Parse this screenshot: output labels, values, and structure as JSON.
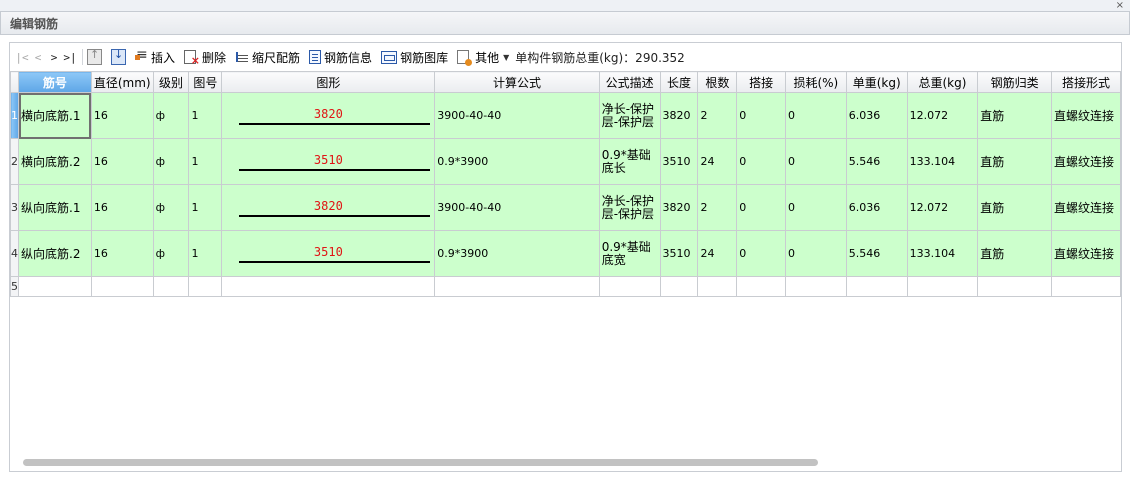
{
  "window": {
    "title": "编辑钢筋",
    "close_glyph": "×"
  },
  "toolbar": {
    "nav": {
      "first": "|<",
      "prev": "<",
      "next": ">",
      "last": ">|"
    },
    "insert_label": "插入",
    "delete_label": "删除",
    "scale_label": "缩尺配筋",
    "info_label": "钢筋信息",
    "library_label": "钢筋图库",
    "other_label": "其他",
    "total_text": "单构件钢筋总重(kg)：290.352"
  },
  "table": {
    "columns": [
      "筋号",
      "直径(mm)",
      "级别",
      "图号",
      "图形",
      "计算公式",
      "公式描述",
      "长度",
      "根数",
      "搭接",
      "损耗(%)",
      "单重(kg)",
      "总重(kg)",
      "钢筋归类",
      "搭接形式"
    ],
    "rows": [
      {
        "num": "1",
        "name": "横向底筋.1",
        "dia": "16",
        "grade": "ф",
        "fig": "1",
        "shape_len": "3820",
        "formula": "3900-40-40",
        "desc": "净长-保护层-保护层",
        "length": "3820",
        "count": "2",
        "lap": "0",
        "loss": "0",
        "unit_w": "6.036",
        "total_w": "12.072",
        "cat": "直筋",
        "lap_type": "直螺纹连接"
      },
      {
        "num": "2",
        "name": "横向底筋.2",
        "dia": "16",
        "grade": "ф",
        "fig": "1",
        "shape_len": "3510",
        "formula": "0.9*3900",
        "desc": "0.9*基础底长",
        "length": "3510",
        "count": "24",
        "lap": "0",
        "loss": "0",
        "unit_w": "5.546",
        "total_w": "133.104",
        "cat": "直筋",
        "lap_type": "直螺纹连接"
      },
      {
        "num": "3",
        "name": "纵向底筋.1",
        "dia": "16",
        "grade": "ф",
        "fig": "1",
        "shape_len": "3820",
        "formula": "3900-40-40",
        "desc": "净长-保护层-保护层",
        "length": "3820",
        "count": "2",
        "lap": "0",
        "loss": "0",
        "unit_w": "6.036",
        "total_w": "12.072",
        "cat": "直筋",
        "lap_type": "直螺纹连接"
      },
      {
        "num": "4",
        "name": "纵向底筋.2",
        "dia": "16",
        "grade": "ф",
        "fig": "1",
        "shape_len": "3510",
        "formula": "0.9*3900",
        "desc": "0.9*基础底宽",
        "length": "3510",
        "count": "24",
        "lap": "0",
        "loss": "0",
        "unit_w": "5.546",
        "total_w": "133.104",
        "cat": "直筋",
        "lap_type": "直螺纹连接"
      }
    ],
    "empty_row_num": "5"
  }
}
